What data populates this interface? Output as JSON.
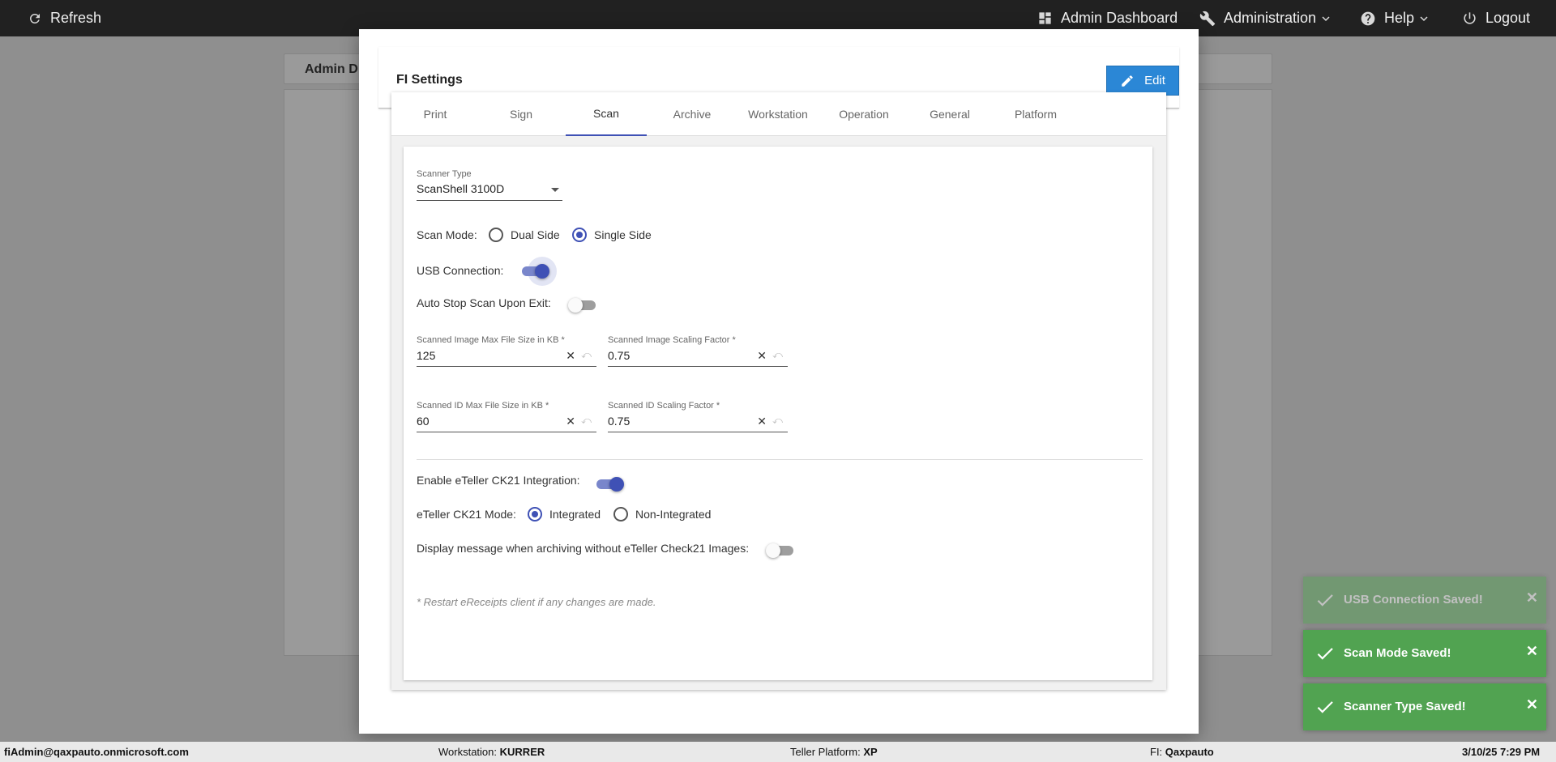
{
  "topbar": {
    "refresh": "Refresh",
    "admin_dashboard": "Admin Dashboard",
    "administration": "Administration",
    "help": "Help",
    "logout": "Logout"
  },
  "background": {
    "panel_title": "Admin D"
  },
  "modal": {
    "title": "FI Settings",
    "edit_label": "Edit",
    "tabs": [
      "Print",
      "Sign",
      "Scan",
      "Archive",
      "Workstation",
      "Operation",
      "General",
      "Platform"
    ],
    "active_tab": "Scan"
  },
  "scan": {
    "scanner_type_label": "Scanner Type",
    "scanner_type_value": "ScanShell 3100D",
    "scan_mode_label": "Scan Mode:",
    "scan_mode_options": [
      "Dual Side",
      "Single Side"
    ],
    "scan_mode_selected": "Single Side",
    "usb_label": "USB Connection:",
    "usb_on": true,
    "auto_stop_label": "Auto Stop Scan Upon Exit:",
    "auto_stop_on": false,
    "img_max_label": "Scanned Image Max File Size in KB *",
    "img_max_value": "125",
    "img_scale_label": "Scanned Image Scaling Factor *",
    "img_scale_value": "0.75",
    "id_max_label": "Scanned ID Max File Size in KB *",
    "id_max_value": "60",
    "id_scale_label": "Scanned ID Scaling Factor *",
    "id_scale_value": "0.75",
    "ck21_label": "Enable eTeller CK21 Integration:",
    "ck21_on": true,
    "ck21_mode_label": "eTeller CK21 Mode:",
    "ck21_mode_options": [
      "Integrated",
      "Non-Integrated"
    ],
    "ck21_mode_selected": "Integrated",
    "display_msg_label": "Display message when archiving without eTeller Check21 Images:",
    "display_msg_on": false,
    "note": "* Restart eReceipts client if any changes are made.",
    "clear_glyph": "✕",
    "undo_glyph": "⤺"
  },
  "toasts": [
    {
      "message": "USB Connection Saved!",
      "faded": true
    },
    {
      "message": "Scan Mode Saved!",
      "faded": false
    },
    {
      "message": "Scanner Type Saved!",
      "faded": false
    }
  ],
  "toast_close_glyph": "✕",
  "statusbar": {
    "user": "fiAdmin@qaxpauto.onmicrosoft.com",
    "workstation_label": "Workstation:",
    "workstation_value": "KURRER",
    "platform_label": "Teller Platform:",
    "platform_value": "XP",
    "fi_label": "FI:",
    "fi_value": "Qaxpauto",
    "datetime": "3/10/25 7:29 PM"
  },
  "colors": {
    "accent": "#3f51b5",
    "edit_button": "#2b87d6",
    "toast": "#51a351",
    "topbar": "#212121"
  },
  "icons": [
    "refresh-icon",
    "dashboard-icon",
    "wrench-icon",
    "help-icon",
    "power-icon",
    "pencil-icon",
    "check-icon",
    "chevron-down-icon"
  ]
}
